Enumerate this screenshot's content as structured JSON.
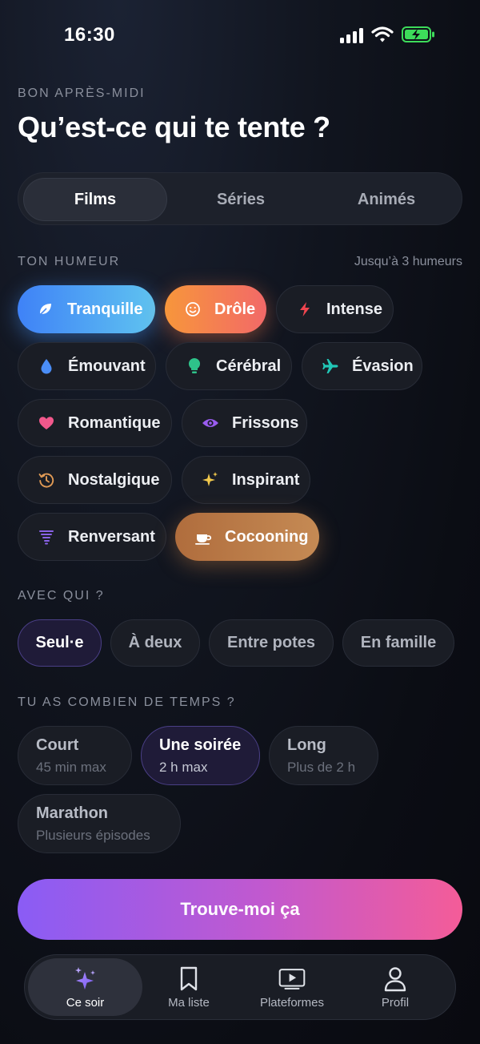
{
  "status_bar": {
    "time": "16:30"
  },
  "header": {
    "greeting": "BON APRÈS-MIDI",
    "title": "Qu’est-ce qui te tente ?"
  },
  "content_tabs": [
    {
      "label": "Films",
      "selected": true
    },
    {
      "label": "Séries",
      "selected": false
    },
    {
      "label": "Animés",
      "selected": false
    }
  ],
  "mood": {
    "section_label": "TON HUMEUR",
    "hint": "Jusqu’à 3 humeurs",
    "chips": [
      {
        "label": "Tranquille",
        "icon": "leaf-icon",
        "selected": true,
        "icon_color": "#ffffff"
      },
      {
        "label": "Drôle",
        "icon": "smiley-icon",
        "selected": true,
        "icon_color": "#ffffff"
      },
      {
        "label": "Intense",
        "icon": "lightning-icon",
        "selected": false,
        "icon_color": "#f0454f"
      },
      {
        "label": "Émouvant",
        "icon": "droplet-icon",
        "selected": false,
        "icon_color": "#4a8df6"
      },
      {
        "label": "Cérébral",
        "icon": "lightbulb-icon",
        "selected": false,
        "icon_color": "#2ec38a"
      },
      {
        "label": "Évasion",
        "icon": "airplane-icon",
        "selected": false,
        "icon_color": "#21c6b6"
      },
      {
        "label": "Romantique",
        "icon": "heart-icon",
        "selected": false,
        "icon_color": "#f2588c"
      },
      {
        "label": "Frissons",
        "icon": "eye-icon",
        "selected": false,
        "icon_color": "#9a5cf0"
      },
      {
        "label": "Nostalgique",
        "icon": "history-clock-icon",
        "selected": false,
        "icon_color": "#e09a55"
      },
      {
        "label": "Inspirant",
        "icon": "sparkles-icon",
        "selected": false,
        "icon_color": "#f2c94c"
      },
      {
        "label": "Renversant",
        "icon": "tornado-icon",
        "selected": false,
        "icon_color": "#8a63e8"
      },
      {
        "label": "Cocooning",
        "icon": "coffee-cup-icon",
        "selected": true,
        "icon_color": "#ffffff"
      }
    ]
  },
  "company": {
    "section_label": "AVEC QUI ?",
    "options": [
      {
        "label": "Seul·e",
        "selected": true
      },
      {
        "label": "À deux",
        "selected": false
      },
      {
        "label": "Entre potes",
        "selected": false
      },
      {
        "label": "En famille",
        "selected": false
      }
    ]
  },
  "duration": {
    "section_label": "TU AS COMBIEN DE TEMPS ?",
    "options": [
      {
        "label": "Court",
        "sub": "45 min max",
        "selected": false
      },
      {
        "label": "Une soirée",
        "sub": "2 h max",
        "selected": true
      },
      {
        "label": "Long",
        "sub": "Plus de 2 h",
        "selected": false
      },
      {
        "label": "Marathon",
        "sub": "Plusieurs épisodes",
        "selected": false
      }
    ]
  },
  "cta": {
    "label": "Trouve-moi ça"
  },
  "tabbar": [
    {
      "label": "Ce soir",
      "icon": "sparkles-icon",
      "active": true
    },
    {
      "label": "Ma liste",
      "icon": "bookmark-icon",
      "active": false
    },
    {
      "label": "Plateformes",
      "icon": "tv-play-icon",
      "active": false
    },
    {
      "label": "Profil",
      "icon": "person-icon",
      "active": false
    }
  ],
  "colors": {
    "accent_purple": "#8a5cf5",
    "accent_pink": "#f45c98",
    "selected_outline": "#4a3f86",
    "battery_green": "#3ddc5a"
  }
}
